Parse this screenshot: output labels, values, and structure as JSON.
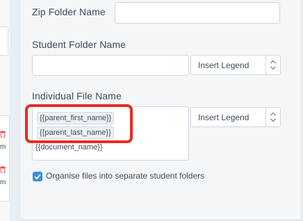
{
  "fields": {
    "zip_label": "Zip Folder Name",
    "zip_value": "",
    "student_label": "Student Folder Name",
    "student_value": "",
    "individual_label": "Individual File Name"
  },
  "file_name_tokens": [
    "{{parent_first_name}}",
    "{{parent_last_name}}",
    "{{document_name}}"
  ],
  "legend_selects": [
    {
      "selected": "Insert Legend"
    },
    {
      "selected": "Insert Legend"
    }
  ],
  "options": {
    "organise_label": "Organise files into separate student folders",
    "organise_checked": true
  },
  "left_list": {
    "truncated": [
      "m",
      "m"
    ]
  },
  "colors": {
    "highlight": "#e52b24",
    "checkbox": "#3d8ee0",
    "delete_icon": "#e5534b"
  }
}
